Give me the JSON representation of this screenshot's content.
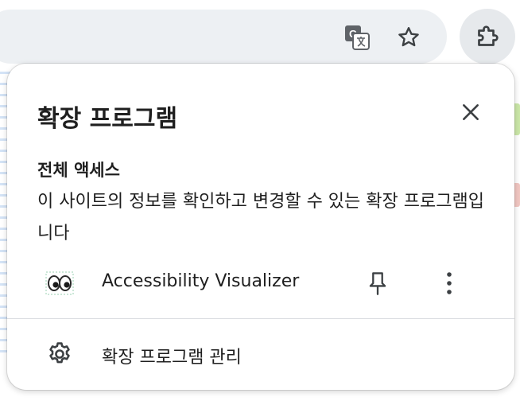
{
  "toolbar": {
    "translate_icon": "translate-icon",
    "bookmark_icon": "star-icon",
    "extensions_icon": "puzzle-icon"
  },
  "popup": {
    "title": "확장 프로그램",
    "close_icon": "close-icon",
    "section": {
      "heading": "전체 액세스",
      "description": "이 사이트의 정보를 확인하고 변경할 수 있는 확장 프로그램입니다"
    },
    "extensions": [
      {
        "name": "Accessibility Visualizer",
        "icon": "eyes-icon",
        "pin_icon": "pin-icon",
        "menu_icon": "more-vert-icon"
      }
    ],
    "manage": {
      "label": "확장 프로그램 관리",
      "icon": "gear-icon"
    }
  },
  "colors": {
    "omnibox_bg": "#edf0f3",
    "text": "#1f1f1f",
    "icon": "#3c4043",
    "divider": "#dadce0"
  }
}
